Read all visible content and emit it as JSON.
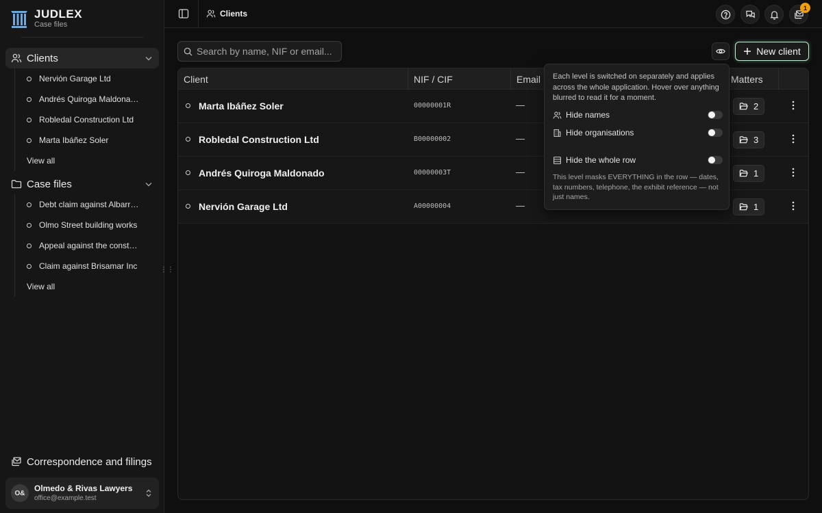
{
  "brand": {
    "name": "JUDLEX",
    "subtitle": "Case files"
  },
  "sidebar": {
    "clients": {
      "label": "Clients",
      "items": [
        "Nervión Garage Ltd",
        "Andrés Quiroga Maldonado",
        "Robledal Construction Ltd",
        "Marta Ibáñez Soler"
      ],
      "view_all": "View all"
    },
    "case_files": {
      "label": "Case files",
      "items": [
        "Debt claim against Albarrán",
        "Olmo Street building works",
        "Appeal against the construction",
        "Claim against Brisamar Inc"
      ],
      "view_all": "View all"
    },
    "correspondence": "Correspondence and filings",
    "account": {
      "initials": "O&",
      "name": "Olmedo & Rivas Lawyers",
      "email": "office@example.test"
    }
  },
  "header": {
    "breadcrumb": "Clients",
    "notification_count": "1"
  },
  "toolbar": {
    "search_placeholder": "Search by name, NIF or email...",
    "new_client_label": "New client"
  },
  "table": {
    "columns": {
      "client": "Client",
      "nif": "NIF / CIF",
      "email": "Email",
      "matters": "Matters"
    },
    "rows": [
      {
        "name": "Marta Ibáñez Soler",
        "nif": "00000001R",
        "email": "—",
        "matters": "2"
      },
      {
        "name": "Robledal Construction Ltd",
        "nif": "B00000002",
        "email": "—",
        "matters": "3"
      },
      {
        "name": "Andrés Quiroga Maldonado",
        "nif": "00000003T",
        "email": "—",
        "matters": "1"
      },
      {
        "name": "Nervión Garage Ltd",
        "nif": "A00000004",
        "email": "—",
        "matters": "1"
      }
    ]
  },
  "privacy_popover": {
    "intro": "Each level is switched on separately and applies across the whole application. Hover over anything blurred to read it for a moment.",
    "options": {
      "hide_names": "Hide names",
      "hide_organisations": "Hide organisations",
      "hide_row": "Hide the whole row"
    },
    "note": "This level masks EVERYTHING in the row — dates, tax numbers, telephone, the exhibit reference — not just names."
  },
  "colors": {
    "background": "#0f0f0f",
    "sidebar": "#161616",
    "accent_outline": "#bff0d0",
    "badge": "#f59e0b"
  }
}
